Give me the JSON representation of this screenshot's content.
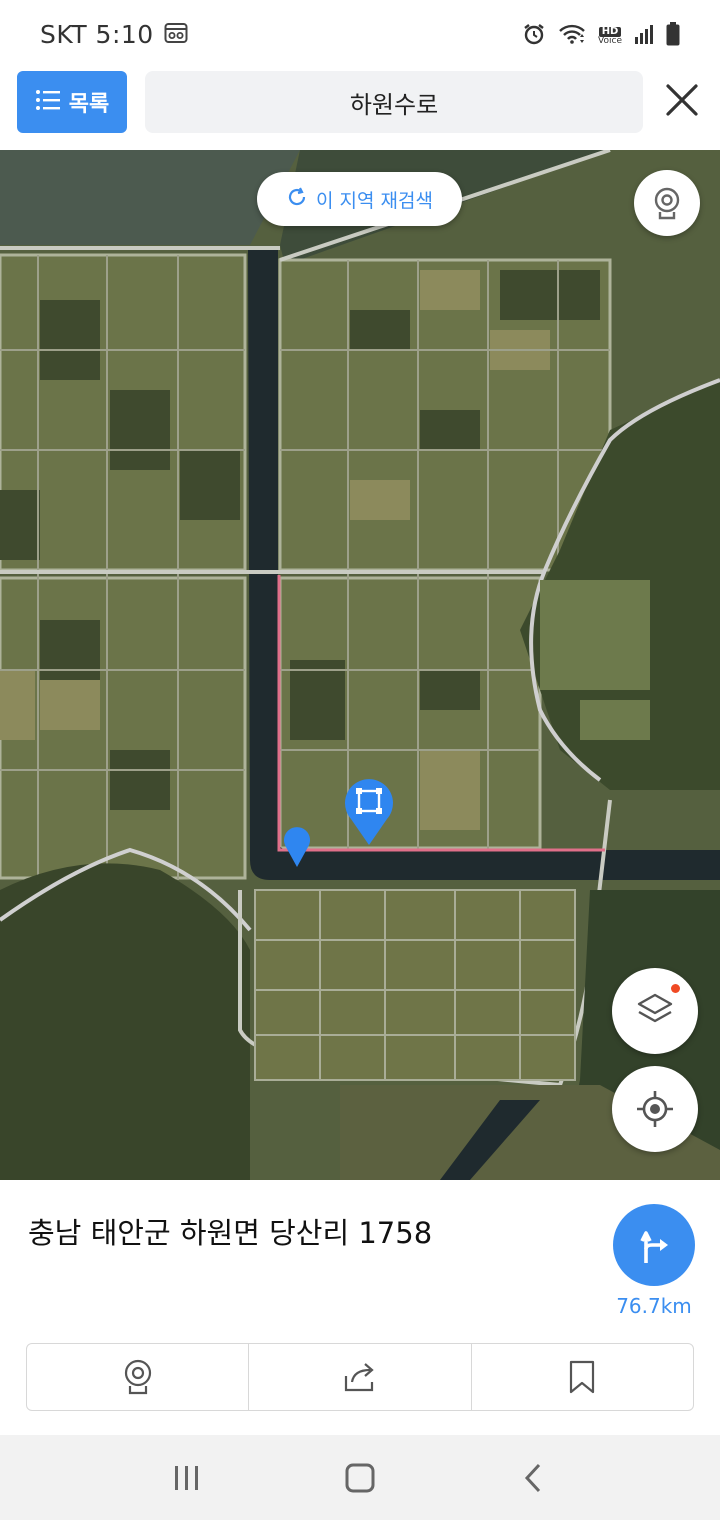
{
  "status_bar": {
    "carrier_time": "SKT 5:10",
    "icons": [
      "screen-record-icon",
      "alarm-icon",
      "wifi-icon",
      "volte-icon",
      "signal-icon",
      "battery-icon"
    ],
    "volte_label": "HD",
    "volte_sub": "Voice"
  },
  "header": {
    "list_label": "목록",
    "search_text": "하원수로"
  },
  "map": {
    "research_label": "이 지역 재검색",
    "route_color": "#e0708a",
    "marker_color": "#2f86f0"
  },
  "info": {
    "address": "충남 태안군 하원면 당산리 1758",
    "distance": "76.7km"
  },
  "actions": [
    "cctv-icon",
    "share-icon",
    "bookmark-icon"
  ],
  "colors": {
    "accent": "#3b8ef0",
    "badge": "#f04a24"
  }
}
